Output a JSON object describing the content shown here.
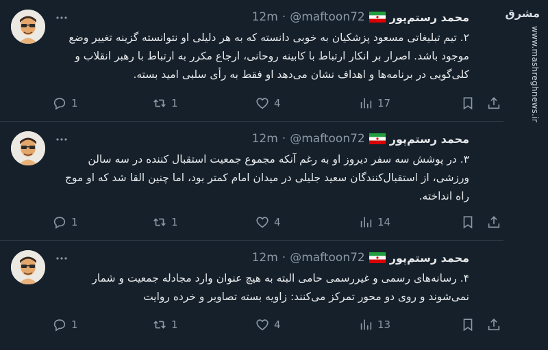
{
  "colors": {
    "background": "#15202b",
    "text": "#e7e9ea",
    "muted": "#8b98a5",
    "divider": "#2f3b47"
  },
  "tweets": [
    {
      "name": "محمد رستم‌پور",
      "handle": "@maftoon72",
      "dot": "·",
      "time": "12m",
      "text": "۲. تیم تبلیغاتی مسعود پزشکیان به خوبی دانسته که به هر دلیلی او نتوانسته گزینه تغییر وضع موجود باشد. اصرار بر انکار ارتباط با کابینه روحانی، ارجاع مکرر به ارتباط با رهبر انقلاب و کلی‌گویی در برنامه‌ها و اهداف نشان می‌دهد او فقط به رأی سلبی امید بسته.",
      "replies": "1",
      "retweets": "1",
      "likes": "4",
      "views": "17"
    },
    {
      "name": "محمد رستم‌پور",
      "handle": "@maftoon72",
      "dot": "·",
      "time": "12m",
      "text": "۳. در پوشش سه سفر دیروز او به رغم آنکه مجموع جمعیت استقبال کننده در سه سالن ورزشی، از استقبال‌کنندگان سعید جلیلی در میدان امام کمتر بود، اما چنین القا شد که او موج راه انداخته.",
      "replies": "1",
      "retweets": "1",
      "likes": "4",
      "views": "14"
    },
    {
      "name": "محمد رستم‌پور",
      "handle": "@maftoon72",
      "dot": "·",
      "time": "12m",
      "text": "۴. رسانه‌های رسمی و غیررسمی حامی البته به هیچ عنوان وارد مجادله جمعیت و شمار نمی‌شوند و روی دو محور تمرکز می‌کنند: زاویه بسته تصاویر و خرده روایت",
      "replies": "1",
      "retweets": "1",
      "likes": "4",
      "views": "13"
    }
  ],
  "icons": [
    "reply-icon",
    "retweet-icon",
    "like-icon",
    "views-icon",
    "bookmark-icon",
    "share-icon",
    "more-icon",
    "iran-flag-icon"
  ],
  "watermark": {
    "logo": "مشرق",
    "url": "www.mashreghnews.ir"
  }
}
